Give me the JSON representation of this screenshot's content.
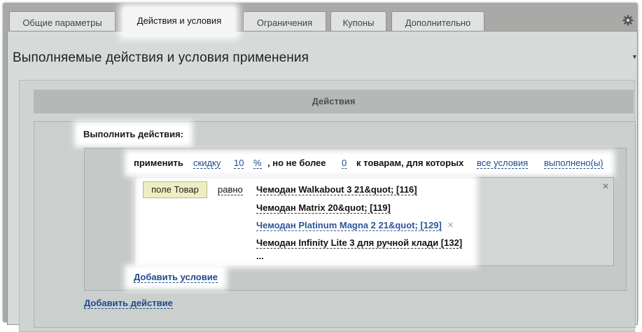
{
  "tabs": [
    {
      "label": "Общие параметры",
      "active": false
    },
    {
      "label": "Действия и условия",
      "active": true
    },
    {
      "label": "Ограничения",
      "active": false
    },
    {
      "label": "Купоны",
      "active": false
    },
    {
      "label": "Дополнительно",
      "active": false
    }
  ],
  "icons": {
    "settings": "gear-icon",
    "collapse": "triangle-down-icon",
    "remove": "close-icon"
  },
  "panel": {
    "title": "Выполняемые действия и условия применения"
  },
  "actions": {
    "header": "Действия",
    "run_label": "Выполнить действия:",
    "rule": {
      "apply": "применить",
      "type": "скидку",
      "value": "10",
      "unit": "%",
      "but_not_more": ", но не более",
      "max_value": "0",
      "to_goods": "к товарам, для которых",
      "scope": "все условия",
      "state": "выполнено(ы)"
    },
    "condition": {
      "field": "поле Товар",
      "operator": "равно",
      "values": [
        "Чемодан Walkabout 3 21&quot; [116]",
        "Чемодан Matrix 20&quot; [119]",
        "Чемодан Platinum Magna 2 21&quot; [129]",
        "Чемодан Infinity Lite 3 для ручной клади [132]"
      ],
      "more": "...",
      "highlighted_index": 2
    },
    "add_condition": "Добавить условие",
    "add_action": "Добавить действие"
  },
  "colors": {
    "link": "#1e4a8c",
    "highlight_item": "#2f5597",
    "field_button": "#eeeec2"
  }
}
